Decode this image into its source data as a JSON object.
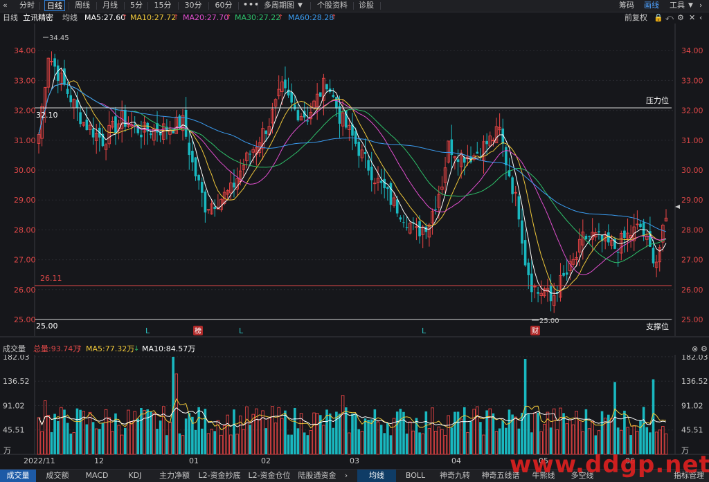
{
  "toolbar": {
    "back_icon": "double-chevron-left-icon",
    "periods": [
      "分时",
      "日线",
      "周线",
      "月线",
      "5分",
      "15分",
      "30分",
      "60分"
    ],
    "active_period": "日线",
    "more_icon": "ellipsis-icon",
    "multi_period": "多周期图",
    "profile": "个股资料",
    "diagnose": "诊股",
    "chips": "筹码",
    "draw": "画线",
    "tools": "工具"
  },
  "main_header": {
    "period": "日线",
    "stock_name": "立讯精密",
    "indicator": "均线",
    "ma": [
      {
        "label": "MA5:27.60",
        "color": "#ffffff"
      },
      {
        "label": "MA10:27.72",
        "color": "#f0c83a"
      },
      {
        "label": "MA20:27.70",
        "color": "#e24fd0"
      },
      {
        "label": "MA30:27.22",
        "color": "#2ec06a"
      },
      {
        "label": "MA60:28.28",
        "color": "#3a9cf0"
      }
    ],
    "adjust": "前复权"
  },
  "price_axis": [
    "34.00",
    "33.00",
    "32.00",
    "31.00",
    "30.00",
    "29.00",
    "28.00",
    "27.00",
    "26.00",
    "25.00"
  ],
  "annotations": {
    "high": "34.45",
    "low": "25.00",
    "resistance_value": "32.10",
    "resistance_label": "压力位",
    "support_value": "26.11",
    "support_bottom": "25.00",
    "support_label": "支撑位"
  },
  "markers": [
    {
      "text": "L",
      "type": "plain"
    },
    {
      "text": "榜",
      "type": "box"
    },
    {
      "text": "L",
      "type": "plain"
    },
    {
      "text": "L",
      "type": "plain"
    },
    {
      "text": "财",
      "type": "box"
    }
  ],
  "volume_header": {
    "title": "成交量",
    "total": "总量:93.74万",
    "ma5": "MA5:77.32万",
    "ma10": "MA10:84.57万"
  },
  "volume_axis": [
    "182.03",
    "136.52",
    "91.02",
    "45.51"
  ],
  "volume_unit": "万",
  "date_axis": [
    "2022/11",
    "12",
    "01",
    "02",
    "03",
    "04",
    "05",
    "06"
  ],
  "bottom_tabs": [
    "成交量",
    "成交额",
    "MACD",
    "KDJ",
    "主力净额",
    "L2-资金抄底",
    "L2-资金仓位",
    "陆股通资金",
    "均线",
    "BOLL",
    "神奇九转",
    "神奇五线谱",
    "牛熊线",
    "多空线"
  ],
  "bottom_right": "指标管理",
  "watermark": "www.ddgp.net",
  "chart_data": {
    "type": "candlestick",
    "ylim": [
      25.0,
      34.45
    ],
    "markers_dates": [
      "12",
      "01",
      "01",
      "04",
      "05"
    ]
  }
}
